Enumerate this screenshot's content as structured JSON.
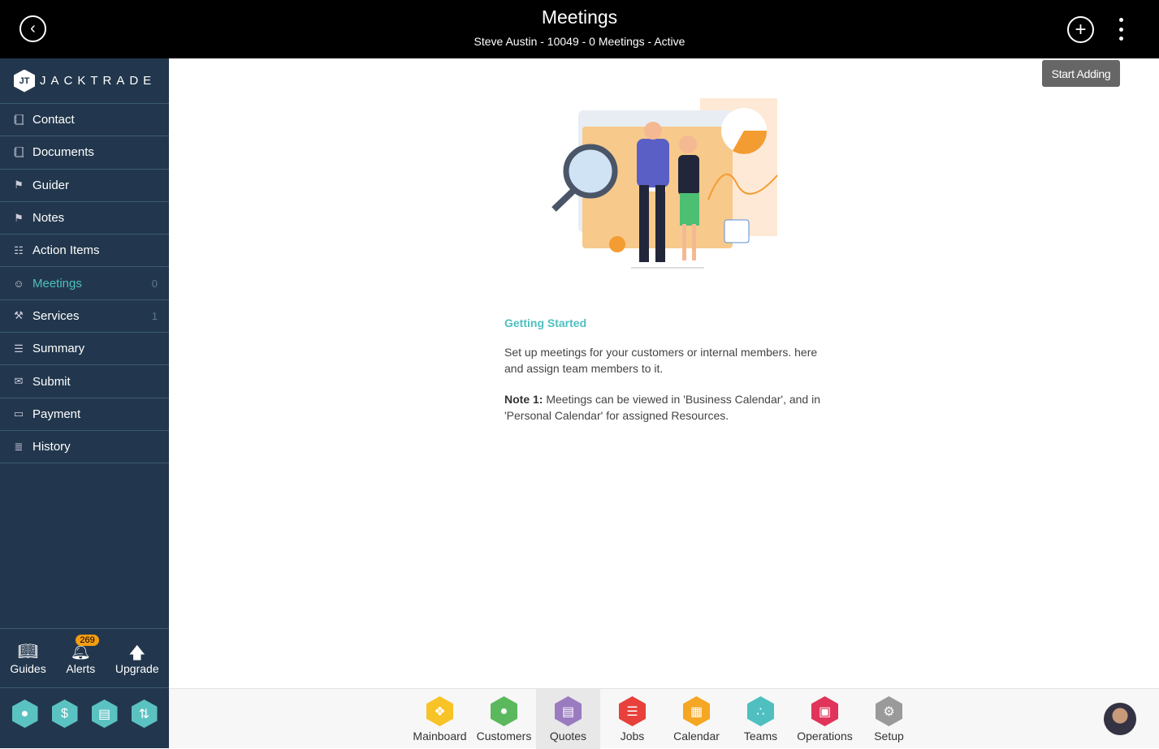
{
  "header": {
    "title": "Meetings",
    "subtitle": "Steve Austin - 10049 - 0 Meetings - Active"
  },
  "brand": {
    "name": "JACKTRADE",
    "mark": "JT"
  },
  "sidebar": {
    "items": [
      {
        "label": "Contact",
        "icon": "contact-book-icon",
        "count": ""
      },
      {
        "label": "Documents",
        "icon": "document-book-icon",
        "count": ""
      },
      {
        "label": "Guider",
        "icon": "signpost-icon",
        "count": ""
      },
      {
        "label": "Notes",
        "icon": "signpost-icon",
        "count": ""
      },
      {
        "label": "Action Items",
        "icon": "clipboard-icon",
        "count": ""
      },
      {
        "label": "Meetings",
        "icon": "meetings-icon",
        "count": "0"
      },
      {
        "label": "Services",
        "icon": "services-icon",
        "count": "1"
      },
      {
        "label": "Summary",
        "icon": "summary-icon",
        "count": ""
      },
      {
        "label": "Submit",
        "icon": "submit-icon",
        "count": ""
      },
      {
        "label": "Payment",
        "icon": "payment-icon",
        "count": ""
      },
      {
        "label": "History",
        "icon": "history-icon",
        "count": ""
      }
    ],
    "tools": {
      "guides": "Guides",
      "alerts": "Alerts",
      "alerts_count": "269",
      "upgrade": "Upgrade"
    }
  },
  "actions": {
    "start_adding": "Start Adding"
  },
  "main": {
    "heading": "Getting Started",
    "description": "Set up meetings for your customers or internal members. here and assign team members to it.",
    "note_label": "Note 1:",
    "note_text": " Meetings can be viewed in 'Business Calendar', and in 'Personal Calendar' for assigned Resources."
  },
  "apps": [
    {
      "label": "Mainboard",
      "color": "#f8c327"
    },
    {
      "label": "Customers",
      "color": "#5cb85c"
    },
    {
      "label": "Quotes",
      "color": "#9b7bc0"
    },
    {
      "label": "Jobs",
      "color": "#e8403a"
    },
    {
      "label": "Calendar",
      "color": "#f5a623"
    },
    {
      "label": "Teams",
      "color": "#4fbfc0"
    },
    {
      "label": "Operations",
      "color": "#e0345a"
    },
    {
      "label": "Setup",
      "color": "#9a9a9a"
    }
  ],
  "colors": {
    "accent": "#4fbfc0",
    "sidebar": "#22374d",
    "badge": "#f39c12"
  }
}
